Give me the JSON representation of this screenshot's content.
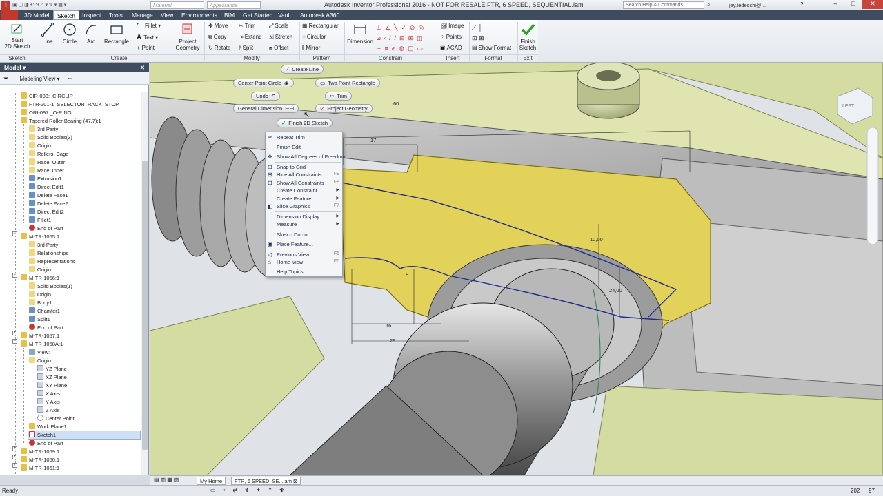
{
  "title_bar": {
    "title": "Autodesk Inventor Professional 2016 - NOT FOR RESALE   FTR, 6 SPEED, SEQUENTIAL.iam",
    "material": "Material",
    "appearance": "Appearance",
    "search_placeholder": "Search Help & Commands...",
    "user": "jay.tedeschi@..."
  },
  "menu_tabs": [
    "3D Model",
    "Sketch",
    "Inspect",
    "Tools",
    "Manage",
    "View",
    "Environments",
    "BIM",
    "Get Started",
    "Vault",
    "Autodesk A360"
  ],
  "ribbon": {
    "start_sketch": "Start\n2D Sketch",
    "line": "Line",
    "circle": "Circle",
    "arc": "Arc",
    "rectangle": "Rectangle",
    "fillet": "Fillet",
    "text": "Text",
    "point": "Point",
    "project_geometry": "Project\nGeometry",
    "move": "Move",
    "copy": "Copy",
    "rotate": "Rotate",
    "trim": "Trim",
    "extend": "Extend",
    "split": "Split",
    "scale": "Scale",
    "stretch": "Stretch",
    "offset": "Offset",
    "rect_pattern": "Rectangular",
    "circ_pattern": "Circular",
    "mirror": "Mirror",
    "dimension": "Dimension",
    "image": "Image",
    "points": "Points",
    "acad": "ACAD",
    "show_format": "Show Format",
    "finish_sketch": "Finish\nSketch",
    "panels": {
      "sketch": "Sketch",
      "create": "Create",
      "modify": "Modify",
      "pattern": "Pattern",
      "constrain": "Constrain",
      "insert": "Insert",
      "format": "Format",
      "exit": "Exit"
    }
  },
  "browser": {
    "header": "Model",
    "view_mode": "Modeling View",
    "items": [
      "CIR-083:_CIRCLIP",
      "FTR-201-1_SELECTOR_RACK_STOP",
      "ORI-097:_O-RING",
      "Tapered Roller Bearing (47.7):1",
      "3rd Party",
      "Solid Bodies(3)",
      "Origin",
      "Rollers, Cage",
      "Race, Outer",
      "Race, Inner",
      "Extrusion1",
      "Direct Edit1",
      "Delete Face1",
      "Delete Face2",
      "Direct Edit2",
      "Fillet1",
      "End of Part",
      "M-TR-1055:1",
      "3rd Party",
      "Relationships",
      "Representations",
      "Origin",
      "M-TR-1056:1",
      "Solid Bodies(1)",
      "Origin",
      "Body1",
      "Chamfer1",
      "Split1",
      "End of Part",
      "M-TR-1057:1",
      "M-TR-1058A:1",
      "View:",
      "Origin",
      "YZ Plane",
      "XZ Plane",
      "XY Plane",
      "X Axis",
      "Y Axis",
      "Z Axis",
      "Center Point",
      "Work Plane1",
      "Sketch1",
      "End of Part",
      "M-TR-1059:1",
      "M-TR-1060:1",
      "M-TR-1061:1"
    ]
  },
  "marking_menu": {
    "create_line": "Create Line",
    "center_point_circle": "Center Point Circle",
    "two_point_rectangle": "Two Point Rectangle",
    "undo": "Undo",
    "trim": "Trim",
    "general_dimension": "General Dimension",
    "project_geometry": "Project Geometry",
    "finish_2d_sketch": "Finish 2D Sketch"
  },
  "context_menu": [
    {
      "label": "Repeat Trim",
      "shortcut": ""
    },
    {
      "label": "Finish Edit",
      "shortcut": ""
    },
    {
      "label": "Show All Degrees of Freedom",
      "shortcut": ""
    },
    {
      "label": "Snap to Grid",
      "shortcut": ""
    },
    {
      "label": "Hide All Constraints",
      "shortcut": "F9"
    },
    {
      "label": "Show All Constraints",
      "shortcut": "F8"
    },
    {
      "label": "Create Constraint",
      "shortcut": ""
    },
    {
      "label": "Create Feature",
      "shortcut": ""
    },
    {
      "label": "Slice Graphics",
      "shortcut": "F7"
    },
    {
      "label": "Dimension Display",
      "shortcut": ""
    },
    {
      "label": "Measure",
      "shortcut": ""
    },
    {
      "label": "Sketch Doctor",
      "shortcut": ""
    },
    {
      "label": "Place Feature...",
      "shortcut": ""
    },
    {
      "label": "Previous View",
      "shortcut": "F5"
    },
    {
      "label": "Home View",
      "shortcut": "F6"
    },
    {
      "label": "Help Topics...",
      "shortcut": ""
    }
  ],
  "dimensions": {
    "d60": "60",
    "d17": "17",
    "d10": "10,00",
    "d8": "8",
    "d24": "24,00",
    "d16": "16",
    "d29": "29"
  },
  "viewcube": "LEFT",
  "tabs": {
    "home": "My Home",
    "doc": "FTR, 6 SPEED, SE...iam"
  },
  "status": {
    "text": "Ready",
    "count1": "202",
    "count2": "97"
  },
  "colors": {
    "menu_bg": "#3f4c5e",
    "sketch_yellow": "#e3d25a",
    "housing_green": "#d5dca2",
    "accent_green": "#2aa12a"
  }
}
